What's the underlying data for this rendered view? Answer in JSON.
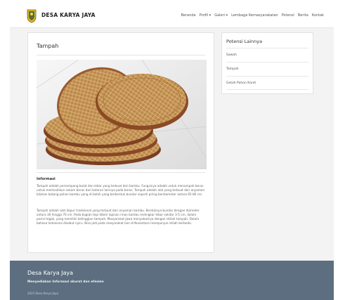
{
  "header": {
    "brand": "DESA KARYA JAYA",
    "menu": [
      "Beranda",
      "Profil ▾",
      "Galeri ▾",
      "Lembaga Kemasyarakatan",
      "Potensi",
      "Berita",
      "Kontak"
    ]
  },
  "main": {
    "title": "Tampah",
    "info_title": "Informasi",
    "paragraphs": [
      "Tampah adalah persempang bulat dan lebar yang terbuat dari bambu. Fungsinya adalah untuk menampah beras untuk memisahkan sekam beras dari kotoran lainnya pada beras. Tampah adalah alat yang terbuat dari anyaman bilahan batang pohon bambu yang di belah yang berbentuk bundar seperti piring berdiameter antara 65-80 cm.",
      "Tampah adalah alat dapur tradisional yang terbuat dari anyaman bambu. Bentuknya bundar dengan diameter antara 36 hingga 70 cm. Pada bagian tepi diberi lapisan rinan bambu melingkar lebar sekitar 3-5 cm, dalam posisi tegak, yang memiliki ketinggian tampah. Masyarakat Jawa menyebutnya dengan istilah tampah. Dalam bahasa Indonesia disebut nyiru. Bisa jadi pada masyarakat lain di Nusantara mempunyai istilah berbeda."
    ]
  },
  "sidebar": {
    "title": "Potensi Lainnya",
    "items": [
      "Sawah",
      "Tampah",
      "Getah Pohon Karet"
    ]
  },
  "footer": {
    "title": "Desa Karya Jaya",
    "subtitle": "Menyediakan Informasi akurat dan efesien",
    "copyright": "2023 Desa Karya Jaya"
  },
  "colors": {
    "footer_bg": "#5c6e80",
    "page_bg": "#f3f3f3",
    "card_bg": "#ffffff"
  },
  "icons": {
    "logo": "village-emblem-icon"
  }
}
